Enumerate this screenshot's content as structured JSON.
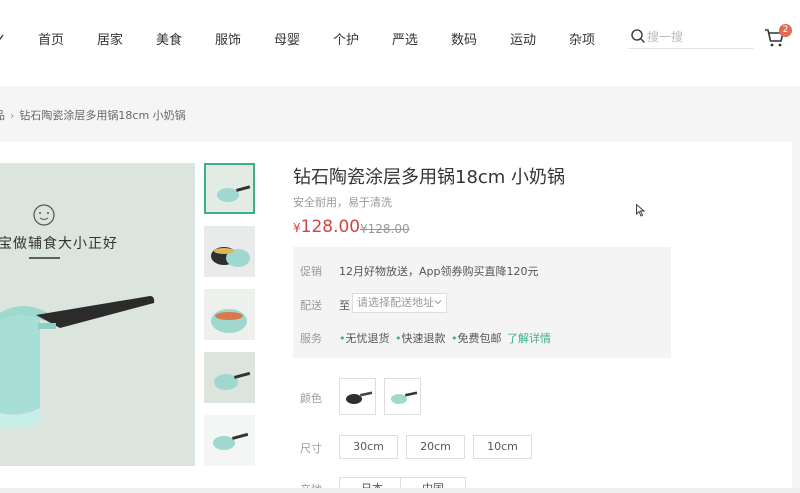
{
  "header": {
    "nav": [
      "首页",
      "居家",
      "美食",
      "服饰",
      "母婴",
      "个护",
      "严选",
      "数码",
      "运动",
      "杂项"
    ],
    "search_placeholder": "搜一搜",
    "cart_count": "2",
    "accent": "#3fae8a"
  },
  "breadcrumb": {
    "prev": "品",
    "current": "钻石陶瓷涂层多用锅18cm 小奶锅"
  },
  "gallery": {
    "slogan": "宝做辅食大小正好",
    "thumb_count": 5
  },
  "product": {
    "title": "钻石陶瓷涂层多用锅18cm 小奶锅",
    "subtitle": "安全耐用，易于清洗",
    "price": "128.00",
    "price_symbol": "¥",
    "original_price": "¥128.00",
    "price_color": "#cf4444"
  },
  "promo": {
    "promo_label": "促销",
    "promo_text": "12月好物放送，App领券购买直降120元",
    "delivery_label": "配送",
    "delivery_prefix": "至",
    "delivery_placeholder": "请选择配送地址",
    "service_label": "服务",
    "services": [
      "无忧退货",
      "快速退款",
      "免费包邮"
    ],
    "more_link": "了解详情"
  },
  "specs": {
    "color_label": "颜色",
    "size_label": "尺寸",
    "sizes": [
      "30cm",
      "20cm",
      "10cm"
    ],
    "origin_label": "产地",
    "origins": [
      "日本",
      "中国"
    ]
  }
}
